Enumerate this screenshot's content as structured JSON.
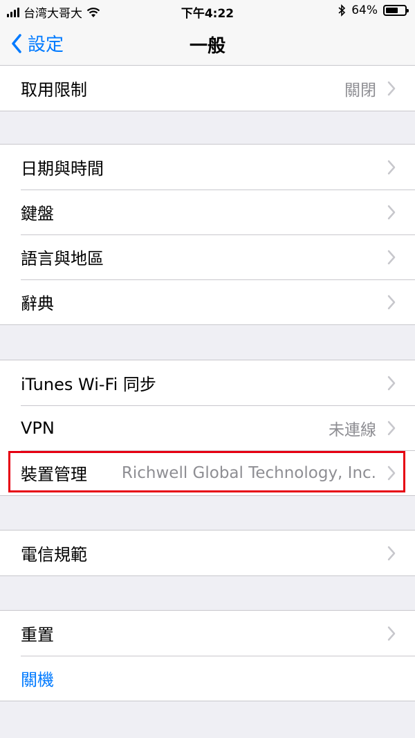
{
  "status_bar": {
    "carrier": "台湾大哥大",
    "time": "下午4:22",
    "battery_percent": "64%",
    "battery_level": 0.64
  },
  "navbar": {
    "back_label": "設定",
    "title": "一般"
  },
  "groups": [
    {
      "rows": [
        {
          "label": "取用限制",
          "value": "關閉"
        }
      ]
    },
    {
      "rows": [
        {
          "label": "日期與時間"
        },
        {
          "label": "鍵盤"
        },
        {
          "label": "語言與地區"
        },
        {
          "label": "辭典"
        }
      ]
    },
    {
      "rows": [
        {
          "label": "iTunes Wi-Fi 同步"
        },
        {
          "label": "VPN",
          "value": "未連線"
        },
        {
          "label": "裝置管理",
          "value": "Richwell Global Technology, Inc."
        }
      ]
    },
    {
      "rows": [
        {
          "label": "電信規範"
        }
      ]
    },
    {
      "rows": [
        {
          "label": "重置"
        },
        {
          "label": "關機"
        }
      ]
    }
  ],
  "colors": {
    "accent": "#007aff",
    "highlight": "#e60012",
    "background": "#efeff4"
  }
}
